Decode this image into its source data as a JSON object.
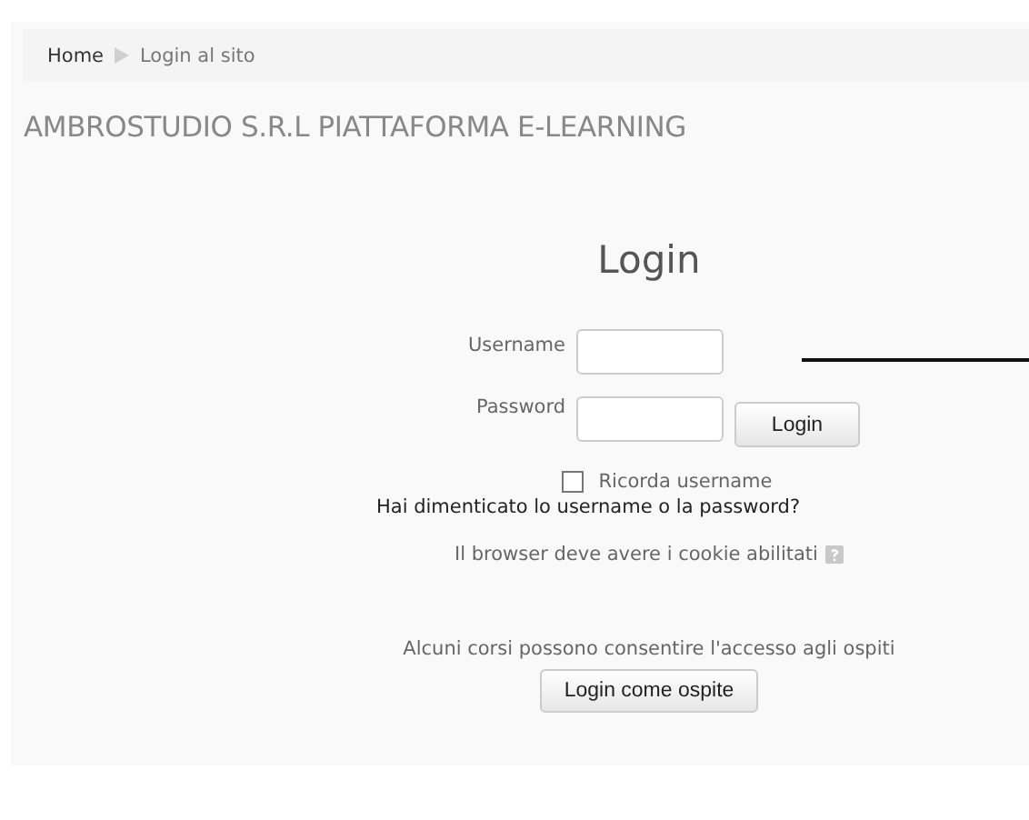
{
  "breadcrumb": [
    {
      "label": "Home"
    },
    {
      "label": "Login al sito"
    }
  ],
  "site_title": "AMBROSTUDIO S.R.L PIATTAFORMA E-LEARNING",
  "login": {
    "title": "Login",
    "fields": [
      {
        "label": "Username"
      },
      {
        "label": "Password"
      }
    ],
    "submit": "Login",
    "remember": {
      "label": "Ricorda username",
      "checked": false
    },
    "forgot_link": "Hai dimenticato lo username o la password?",
    "cookie_note": "Il browser deve avere i cookie abilitati"
  },
  "guest": {
    "note": "Alcuni corsi possono consentire l'accesso agli ospiti",
    "button": "Login come ospite"
  }
}
